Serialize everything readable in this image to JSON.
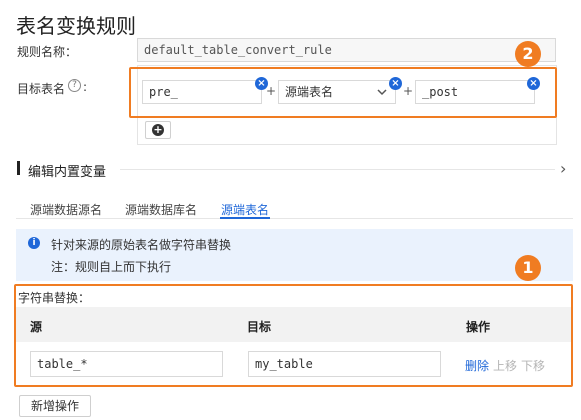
{
  "page": {
    "title": "表名变换规则"
  },
  "rule_name": {
    "label": "规则名称：",
    "value": "default_table_convert_rule"
  },
  "target_table": {
    "label": "目标表名",
    "help_icon": "?",
    "prefix_value": "pre_",
    "source_select_value": "源端表名",
    "suffix_value": "_post",
    "plus_sign": "+",
    "remove_icon": "×",
    "add_icon": "+"
  },
  "badges": {
    "one": "1",
    "two": "2"
  },
  "edit_section": {
    "title": "编辑内置变量",
    "chevron": "›"
  },
  "tabs": [
    {
      "label": "源端数据源名"
    },
    {
      "label": "源端数据库名"
    },
    {
      "label": "源端表名"
    }
  ],
  "info": {
    "icon": "i",
    "line1": "针对来源的原始表名做字符串替换",
    "line2": "注：规则自上而下执行"
  },
  "replace": {
    "label": "字符串替换：",
    "headers": {
      "source": "源",
      "target": "目标",
      "action": "操作"
    },
    "rows": [
      {
        "source": "table_*",
        "target": "my_table",
        "delete": "删除",
        "up": "上移",
        "down": "下移"
      }
    ],
    "add_button": "新增操作"
  },
  "colors": {
    "accent": "#f07c22",
    "primary": "#1f67d8",
    "info_bg": "#eaf2fd"
  }
}
